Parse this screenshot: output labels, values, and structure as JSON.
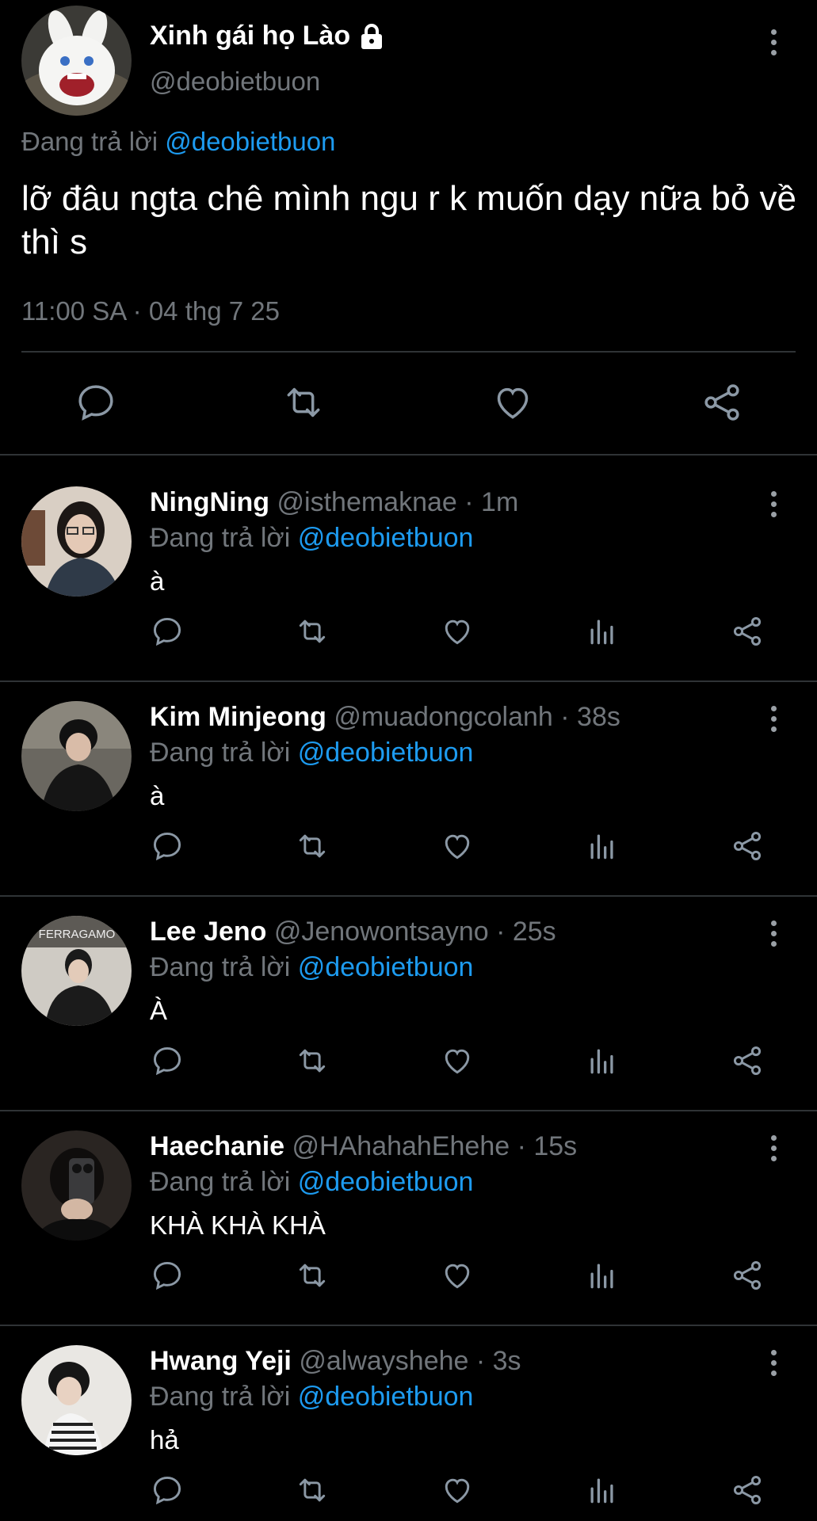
{
  "main_tweet": {
    "display_name": "Xinh gái họ Lào",
    "handle": "@deobietbuon",
    "replying_prefix": "Đang trả lời",
    "replying_to": "@deobietbuon",
    "text": "lỡ đâu ngta chê mình ngu r k muốn dạy nữa bỏ về thì s",
    "timestamp": "11:00 SA · 04 thg 7 25",
    "avatar_icon": "white-rabbit-avatar",
    "verified_icon": "lock-icon"
  },
  "replies": [
    {
      "display_name": "NingNing",
      "meta": "@isthemaknae · 1m",
      "replying_prefix": "Đang trả lời",
      "replying_to": "@deobietbuon",
      "text": "à"
    },
    {
      "display_name": "Kim Minjeong",
      "meta": "@muadongcolanh · 38s",
      "replying_prefix": "Đang trả lời",
      "replying_to": "@deobietbuon",
      "text": "à"
    },
    {
      "display_name": "Lee Jeno",
      "meta": "@Jenowontsayno · 25s",
      "replying_prefix": "Đang trả lời",
      "replying_to": "@deobietbuon",
      "text": "À",
      "avatar_text": "FERRAGAMO"
    },
    {
      "display_name": "Haechanie",
      "meta": "@HAhahahEhehe · 15s",
      "replying_prefix": "Đang trả lời",
      "replying_to": "@deobietbuon",
      "text": "KHÀ KHÀ KHÀ"
    },
    {
      "display_name": "Hwang Yeji",
      "meta": "@alwayshehe · 3s",
      "replying_prefix": "Đang trả lời",
      "replying_to": "@deobietbuon",
      "text": "hả"
    }
  ],
  "colors": {
    "background": "#000000",
    "text": "#e7e9ea",
    "secondary": "#71767b",
    "accent": "#1d9bf0",
    "divider": "#2f3336"
  }
}
